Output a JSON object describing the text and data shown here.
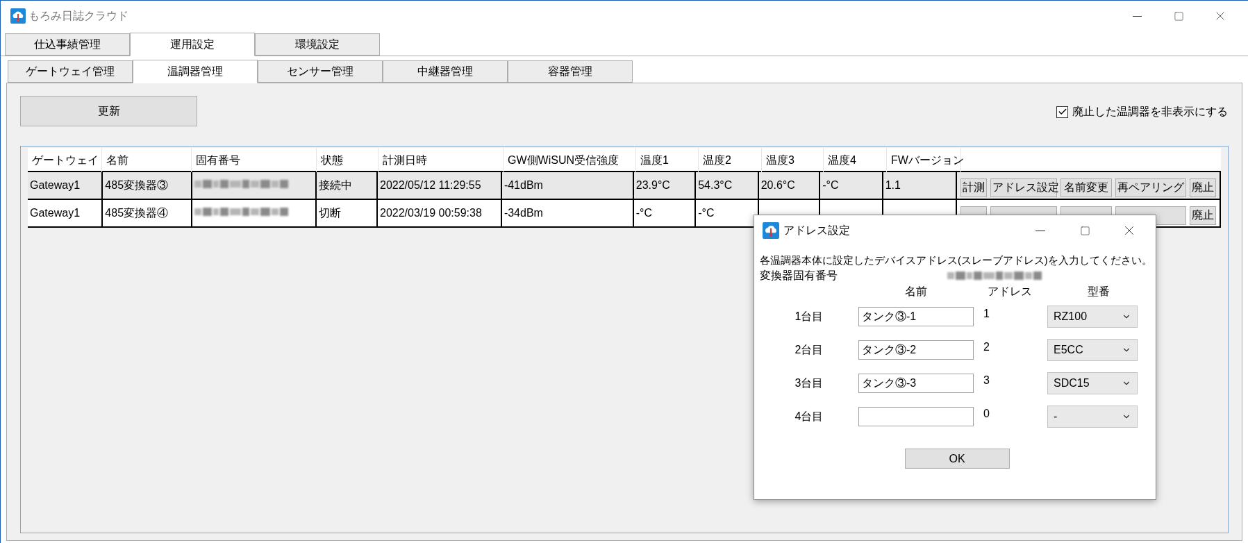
{
  "window": {
    "title": "もろみ日誌クラウド"
  },
  "main_tabs": [
    {
      "label": "仕込事績管理",
      "selected": false
    },
    {
      "label": "運用設定",
      "selected": true
    },
    {
      "label": "環境設定",
      "selected": false
    }
  ],
  "sub_tabs": [
    {
      "label": "ゲートウェイ管理",
      "selected": false
    },
    {
      "label": "温調器管理",
      "selected": true
    },
    {
      "label": "センサー管理",
      "selected": false
    },
    {
      "label": "中継器管理",
      "selected": false
    },
    {
      "label": "容器管理",
      "selected": false
    }
  ],
  "refresh_button": "更新",
  "hide_checkbox": {
    "label": "廃止した温調器を非表示にする",
    "checked": true
  },
  "table": {
    "columns": [
      "ゲートウェイ",
      "名前",
      "固有番号",
      "状態",
      "計測日時",
      "GW側WiSUN受信強度",
      "温度1",
      "温度2",
      "温度3",
      "温度4",
      "FWバージョン"
    ],
    "rows": [
      {
        "selected": true,
        "gateway": "Gateway1",
        "name": "485変換器③",
        "serial_redacted": true,
        "status": "接続中",
        "measured_at": "2022/05/12 11:29:55",
        "signal": "-41dBm",
        "temp1": "23.9°C",
        "temp2": "54.3°C",
        "temp3": "20.6°C",
        "temp4": "-°C",
        "fw": "1.1",
        "actions": [
          {
            "kind": "button",
            "label": "計測"
          },
          {
            "kind": "button",
            "label": "アドレス設定"
          },
          {
            "kind": "button",
            "label": "名前変更"
          },
          {
            "kind": "button",
            "label": "再ペアリング"
          },
          {
            "kind": "button",
            "label": "廃止"
          }
        ]
      },
      {
        "selected": false,
        "gateway": "Gateway1",
        "name": "485変換器④",
        "serial_redacted": true,
        "status": "切断",
        "measured_at": "2022/03/19 00:59:38",
        "signal": "-34dBm",
        "temp1": "-°C",
        "temp2": "-°C",
        "actions": [
          {
            "kind": "covered"
          },
          {
            "kind": "covered"
          },
          {
            "kind": "covered"
          },
          {
            "kind": "covered"
          },
          {
            "kind": "button",
            "label": "廃止"
          }
        ]
      }
    ]
  },
  "dialog": {
    "title": "アドレス設定",
    "instruction": "各温調器本体に設定したデバイスアドレス(スレーブアドレス)を入力してください。",
    "serial_label": "変換器固有番号",
    "serial_redacted": true,
    "columns": [
      "名前",
      "アドレス",
      "型番"
    ],
    "units": [
      {
        "label": "1台目",
        "name": "タンク③-1",
        "address": "1",
        "model": "RZ100"
      },
      {
        "label": "2台目",
        "name": "タンク③-2",
        "address": "2",
        "model": "E5CC"
      },
      {
        "label": "3台目",
        "name": "タンク③-3",
        "address": "3",
        "model": "SDC15"
      },
      {
        "label": "4台目",
        "address": "0",
        "model": "-"
      }
    ],
    "ok_button": "OK"
  }
}
